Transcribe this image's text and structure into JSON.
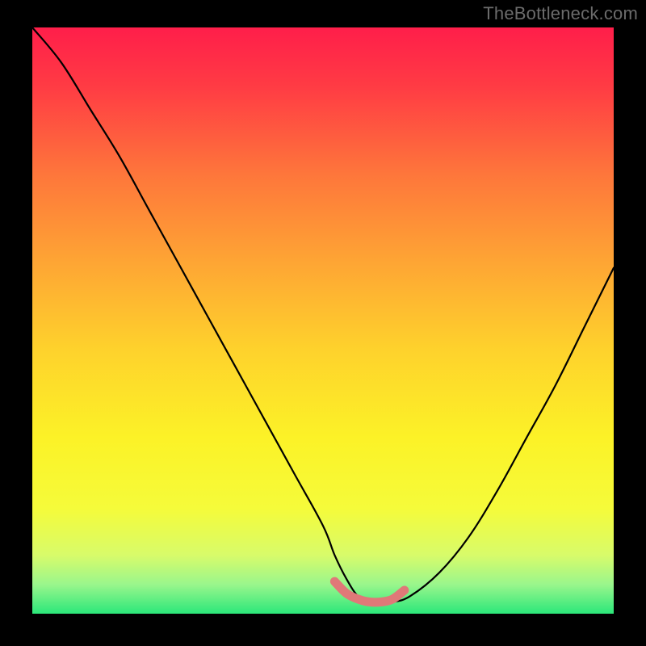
{
  "watermark": "TheBottleneck.com",
  "chart_data": {
    "type": "line",
    "title": "",
    "xlabel": "",
    "ylabel": "",
    "xlim": [
      0,
      100
    ],
    "ylim": [
      0,
      100
    ],
    "series": [
      {
        "name": "black-curve",
        "stroke": "#000000",
        "x": [
          0,
          5,
          10,
          15,
          20,
          25,
          30,
          35,
          40,
          45,
          50,
          52,
          54,
          56,
          58,
          60,
          62,
          65,
          70,
          75,
          80,
          85,
          90,
          95,
          100
        ],
        "y": [
          100,
          94,
          86,
          78,
          69,
          60,
          51,
          42,
          33,
          24,
          15,
          10,
          6,
          3,
          2,
          2,
          2,
          3,
          7,
          13,
          21,
          30,
          39,
          49,
          59
        ]
      },
      {
        "name": "pink-segment",
        "stroke": "#E07878",
        "x": [
          52,
          54,
          56,
          58,
          60,
          62,
          64
        ],
        "y": [
          5.5,
          3.5,
          2.5,
          2.0,
          2.0,
          2.5,
          4.0
        ]
      }
    ],
    "background_gradient": {
      "type": "vertical",
      "stops": [
        {
          "pos": 0.0,
          "color": "#FF1E4A"
        },
        {
          "pos": 0.1,
          "color": "#FF3B44"
        },
        {
          "pos": 0.25,
          "color": "#FE763B"
        },
        {
          "pos": 0.4,
          "color": "#FEA534"
        },
        {
          "pos": 0.55,
          "color": "#FED22C"
        },
        {
          "pos": 0.7,
          "color": "#FCF227"
        },
        {
          "pos": 0.82,
          "color": "#F5FB3A"
        },
        {
          "pos": 0.9,
          "color": "#D8FB6A"
        },
        {
          "pos": 0.95,
          "color": "#9AF68C"
        },
        {
          "pos": 1.0,
          "color": "#2BE77A"
        }
      ]
    }
  }
}
